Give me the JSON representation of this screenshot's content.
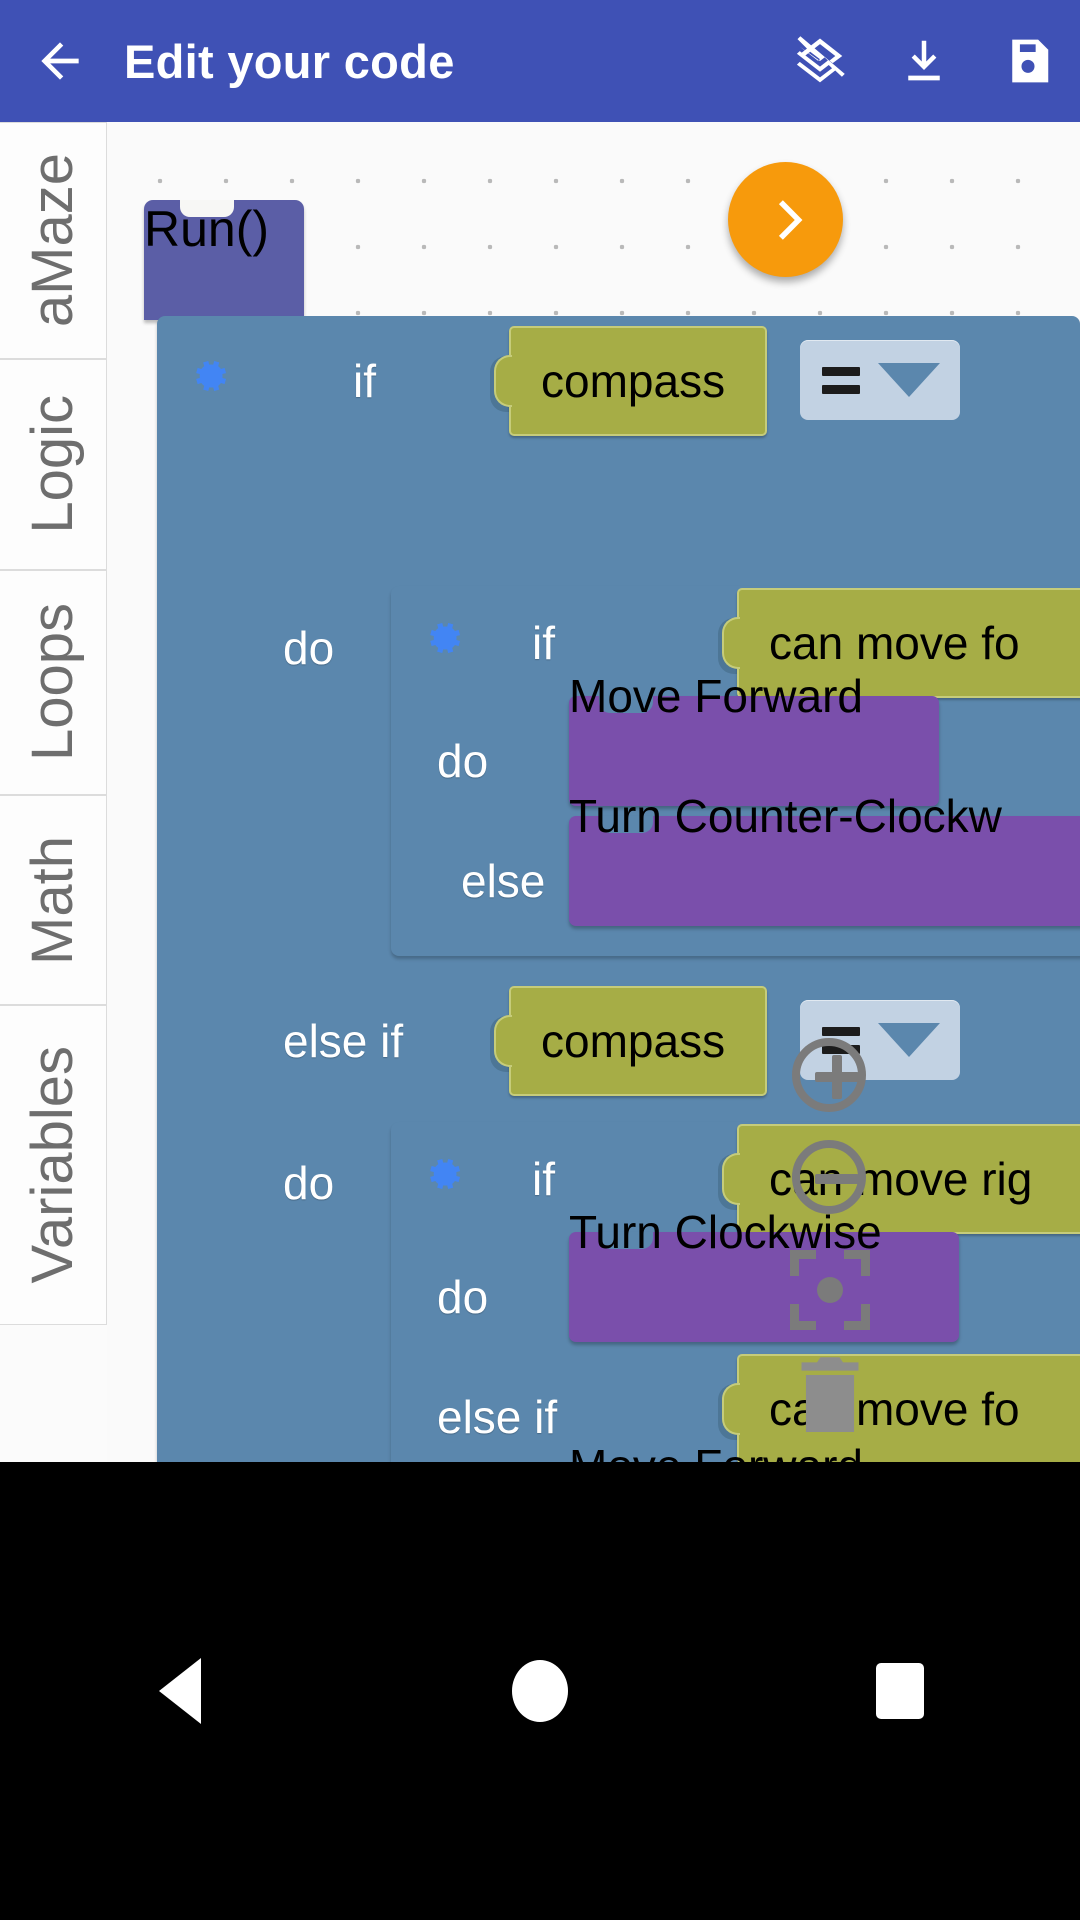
{
  "appbar": {
    "back_icon": "arrow-left-icon",
    "title": "Edit your code",
    "actions": [
      {
        "name": "layers-off-icon",
        "label": "Layers off"
      },
      {
        "name": "download-icon",
        "label": "Download"
      },
      {
        "name": "save-icon",
        "label": "Save"
      }
    ]
  },
  "toolbox": {
    "categories": [
      {
        "label": "aMaze"
      },
      {
        "label": "Logic"
      },
      {
        "label": "Loops"
      },
      {
        "label": "Math"
      },
      {
        "label": "Variables"
      }
    ]
  },
  "workspace": {
    "run_block": {
      "label": "Run()"
    },
    "keywords": {
      "if": "if",
      "do": "do",
      "else": "else",
      "else_if": "else if"
    },
    "blocks": {
      "compass_1": "compass",
      "compass_2": "compass",
      "can_move_forward_1": "can move fo",
      "can_move_right": "can move rig",
      "can_move_forward_2": "can move fo",
      "move_forward_1": "Move Forward",
      "turn_counter_clockwise": "Turn Counter-Clockw",
      "turn_clockwise": "Turn Clockwise",
      "move_forward_2": "Move Forward"
    },
    "dropdowns": {
      "operator_1": "=",
      "operator_2": "="
    }
  },
  "overlay": {
    "run_button": "play-icon",
    "zoom_in": "zoom-in-icon",
    "zoom_out": "zoom-out-icon",
    "center": "center-target-icon",
    "trash": "trash-icon"
  },
  "navbar": {
    "back": "nav-back-icon",
    "home": "nav-home-icon",
    "recents": "nav-recents-icon"
  },
  "colors": {
    "appbar": "#3f51b5",
    "run_block": "#5b5ea6",
    "control_block": "#5b87ad",
    "value_block": "#a6ad46",
    "action_block": "#7a4fab",
    "fab": "#f79a0c"
  }
}
